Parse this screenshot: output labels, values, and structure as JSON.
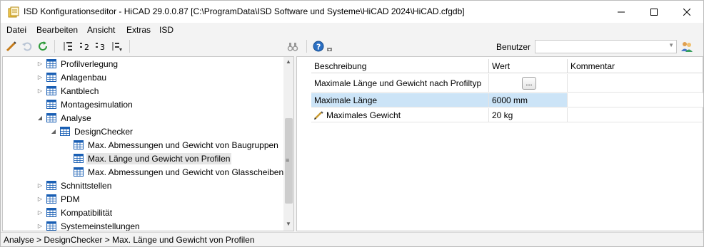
{
  "window": {
    "title": "ISD Konfigurationseditor  - HiCAD 29.0.0.87 [C:\\ProgramData\\ISD Software und Systeme\\HiCAD 2024\\HiCAD.cfgdb]"
  },
  "menu": [
    "Datei",
    "Bearbeiten",
    "Ansicht",
    "Extras",
    "ISD"
  ],
  "toolbar": {
    "benutzer_label": "Benutzer",
    "benutzer_value": ""
  },
  "tree": {
    "items": [
      {
        "label": "Profilverlegung",
        "level": 0,
        "expander": "collapsed"
      },
      {
        "label": "Anlagenbau",
        "level": 0,
        "expander": "collapsed"
      },
      {
        "label": "Kantblech",
        "level": 0,
        "expander": "collapsed"
      },
      {
        "label": "Montagesimulation",
        "level": 0,
        "expander": "none"
      },
      {
        "label": "Analyse",
        "level": 0,
        "expander": "expanded"
      },
      {
        "label": "DesignChecker",
        "level": 1,
        "expander": "expanded"
      },
      {
        "label": "Max. Abmessungen und Gewicht von Baugruppen",
        "level": 2,
        "expander": "none"
      },
      {
        "label": "Max. Länge und Gewicht von Profilen",
        "level": 2,
        "expander": "none",
        "selected": true
      },
      {
        "label": "Max. Abmessungen und Gewicht von Glasscheiben",
        "level": 2,
        "expander": "none"
      },
      {
        "label": "Schnittstellen",
        "level": 0,
        "expander": "collapsed"
      },
      {
        "label": "PDM",
        "level": 0,
        "expander": "collapsed"
      },
      {
        "label": "Kompatibilität",
        "level": 0,
        "expander": "collapsed"
      },
      {
        "label": "Systemeinstellungen",
        "level": 0,
        "expander": "collapsed"
      }
    ]
  },
  "grid": {
    "headers": {
      "beschreibung": "Beschreibung",
      "wert": "Wert",
      "kommentar": "Kommentar"
    },
    "rows": [
      {
        "beschreibung": "Maximale Länge und Gewicht nach Profiltyp",
        "wert": "",
        "button": "...",
        "kommentar": ""
      },
      {
        "beschreibung": "Maximale Länge",
        "wert": "6000 mm",
        "kommentar": ""
      },
      {
        "beschreibung": "Maximales Gewicht",
        "wert": "20 kg",
        "kommentar": ""
      }
    ]
  },
  "status": {
    "path": "Analyse > DesignChecker > Max. Länge und Gewicht von Profilen"
  },
  "colors": {
    "selection": "#cce4f7",
    "tree_icon": "#1a5fb4"
  }
}
